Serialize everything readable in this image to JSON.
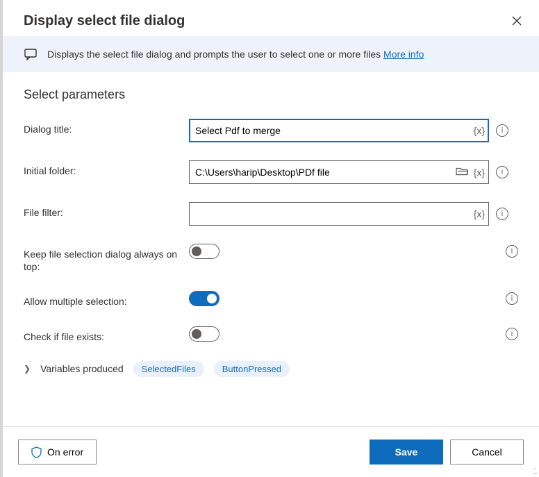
{
  "header": {
    "title": "Display select file dialog"
  },
  "banner": {
    "text": "Displays the select file dialog and prompts the user to select one or more files ",
    "link": "More info"
  },
  "section_title": "Select parameters",
  "fields": {
    "dialog_title": {
      "label": "Dialog title:",
      "value": "Select Pdf to merge"
    },
    "initial_folder": {
      "label": "Initial folder:",
      "value": "C:\\Users\\harip\\Desktop\\PDf file"
    },
    "file_filter": {
      "label": "File filter:",
      "value": ""
    },
    "keep_on_top": {
      "label": "Keep file selection dialog always on top:",
      "on": false
    },
    "allow_multi": {
      "label": "Allow multiple selection:",
      "on": true
    },
    "check_exists": {
      "label": "Check if file exists:",
      "on": false
    }
  },
  "variables": {
    "title": "Variables produced",
    "items": [
      "SelectedFiles",
      "ButtonPressed"
    ]
  },
  "footer": {
    "on_error": "On error",
    "save": "Save",
    "cancel": "Cancel"
  },
  "fx_token": "{x}"
}
